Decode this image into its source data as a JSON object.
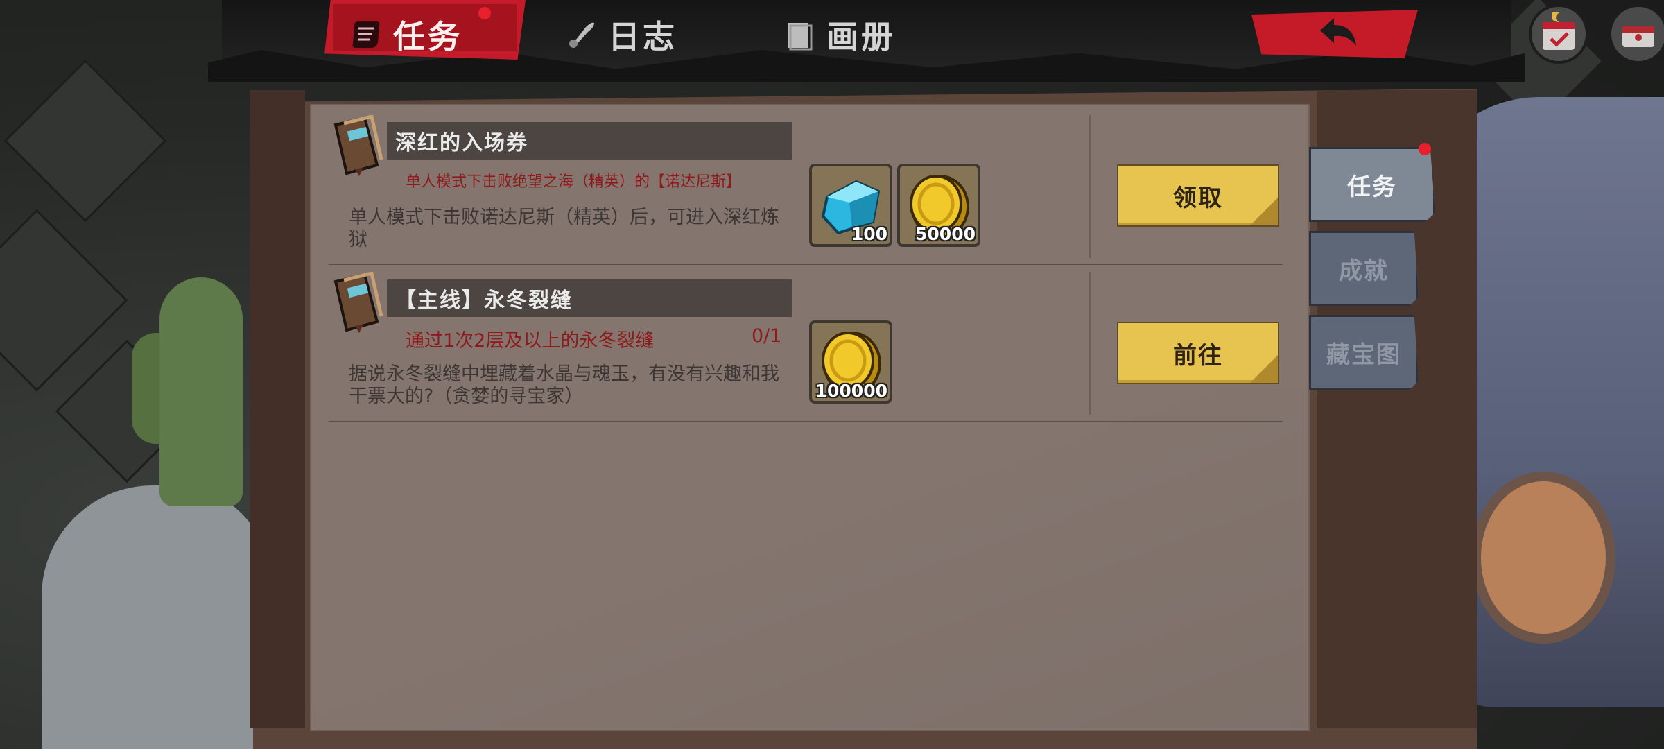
{
  "top_tabs": [
    {
      "label": "任务",
      "icon": "scroll-icon",
      "active": true,
      "badge": true
    },
    {
      "label": "日志",
      "icon": "quill-icon",
      "active": false
    },
    {
      "label": "画册",
      "icon": "book-icon",
      "active": false
    }
  ],
  "side_tabs": [
    {
      "label": "任务",
      "active": true,
      "badge": true
    },
    {
      "label": "成就",
      "active": false
    },
    {
      "label": "藏宝图",
      "active": false
    }
  ],
  "quests": [
    {
      "title": "深红的入场券",
      "requirement": "单人模式下击败绝望之海（精英）的【诺达尼斯】",
      "progress": "",
      "description": "单人模式下击败诺达尼斯（精英）后，可进入深红炼狱",
      "rewards": [
        {
          "item": "crystal-icon",
          "count": "100"
        },
        {
          "item": "gold-coin-icon",
          "count": "50000"
        }
      ],
      "action": "领取"
    },
    {
      "title": "【主线】永冬裂缝",
      "requirement": "通过1次2层及以上的永冬裂缝",
      "progress": "0/1",
      "description": "据说永冬裂缝中埋藏着水晶与魂玉，有没有兴趣和我干票大的?（贪婪的寻宝家）",
      "rewards": [
        {
          "item": "gold-coin-icon",
          "count": "100000"
        }
      ],
      "action": "前往"
    }
  ],
  "colors": {
    "active_tab": "#c41a2a",
    "panel": "#84766f",
    "action_button": "#e6c44f",
    "requirement_text": "#8e1a1c"
  }
}
